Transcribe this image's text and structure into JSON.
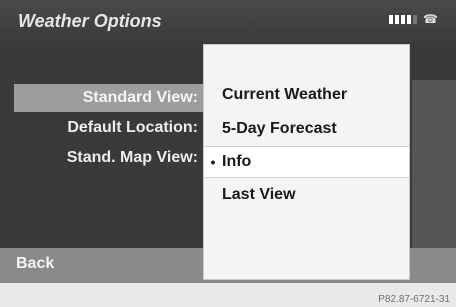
{
  "header": {
    "title": "Weather Options",
    "status_icons": [
      "signal-strength-icon",
      "phone-icon"
    ]
  },
  "settings": {
    "rows": [
      {
        "label": "Standard View:"
      },
      {
        "label": "Default Location:"
      },
      {
        "label": "Stand. Map View:"
      }
    ],
    "selected_row": "Standard View:"
  },
  "dropdown": {
    "options": [
      {
        "label": "Current Weather",
        "bullet": ""
      },
      {
        "label": "5-Day Forecast",
        "bullet": ""
      },
      {
        "label": "Info",
        "bullet": "•"
      },
      {
        "label": "Last View",
        "bullet": ""
      }
    ],
    "selected_option": "Info"
  },
  "footer": {
    "back_label": "Back"
  },
  "caption": "P82.87-6721-31",
  "colors": {
    "screen_bg": "#3a3a3a",
    "selected_row_bg": "#9d9d9d",
    "dropdown_bg": "#f4f4f4",
    "back_bar_bg": "#8a8a8a"
  }
}
